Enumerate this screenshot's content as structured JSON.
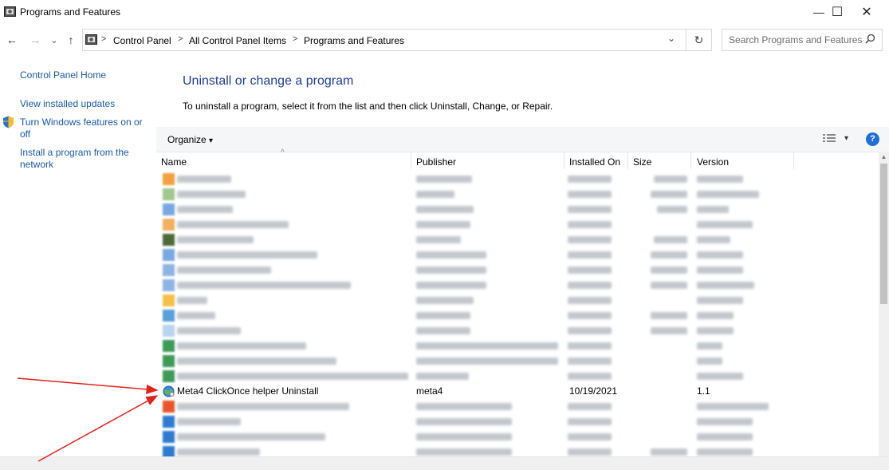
{
  "window": {
    "title": "Programs and Features",
    "minimize": "—",
    "maximize": "☐",
    "close": "✕"
  },
  "nav": {
    "back": "←",
    "forward": "→",
    "recent": "⌄",
    "up": "↑"
  },
  "address": {
    "crumbs": [
      "Control Panel",
      "All Control Panel Items",
      "Programs and Features"
    ],
    "separator": ">",
    "dropdown": "⌄",
    "refresh": "↻"
  },
  "search": {
    "placeholder": "Search Programs and Features",
    "icon": "search-icon"
  },
  "sidebar": {
    "home": "Control Panel Home",
    "links": [
      "View installed updates",
      "Turn Windows features on or off",
      "Install a program from the network"
    ]
  },
  "main": {
    "heading": "Uninstall or change a program",
    "instructions": "To uninstall a program, select it from the list and then click Uninstall, Change, or Repair."
  },
  "toolbar": {
    "organize": "Organize",
    "dropdown": "▾",
    "help": "?"
  },
  "table": {
    "sort_indicator": "^",
    "columns": [
      "Name",
      "Publisher",
      "Installed On",
      "Size",
      "Version"
    ],
    "highlighted_row": {
      "name": "Meta4 ClickOnce helper Uninstall",
      "publisher": "meta4",
      "installed_on": "10/19/2021",
      "size": "",
      "version": "1.1"
    }
  },
  "colors": {
    "link": "#1a5aa6",
    "heading": "#1e3d9c",
    "arrow": "#e0231c"
  }
}
